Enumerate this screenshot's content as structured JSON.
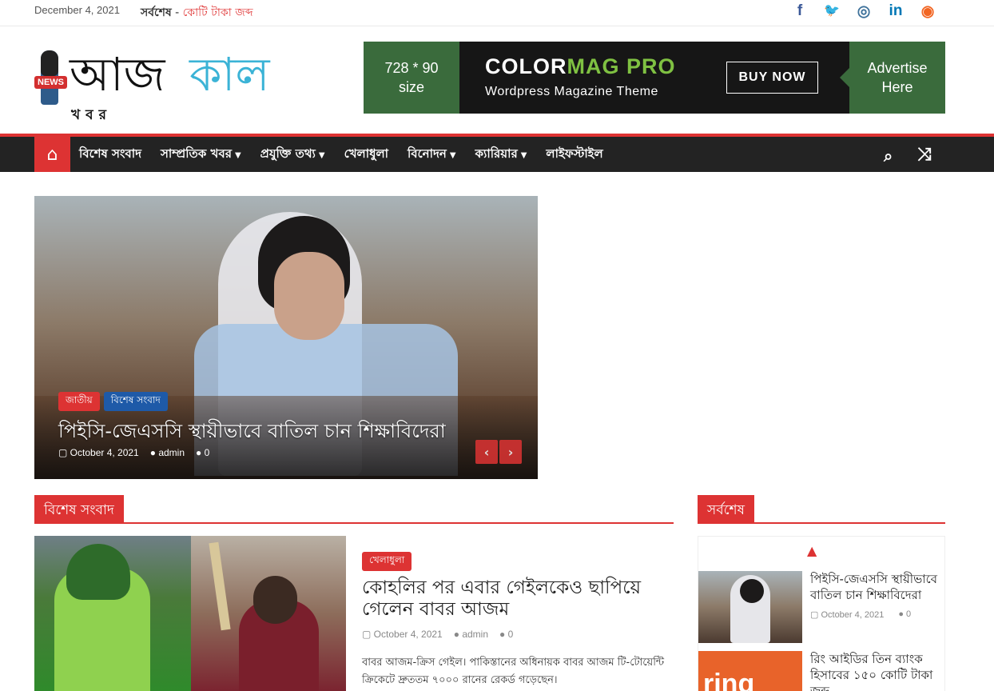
{
  "topbar": {
    "date": "December 4, 2021",
    "breaking_label": "সর্বশেষ",
    "breaking_sep": " - ",
    "breaking_text": "কোটি টাকা জব্দ"
  },
  "social": [
    {
      "icon": "facebook-icon",
      "glyph": "f",
      "color": "#3b5998"
    },
    {
      "icon": "twitter-icon",
      "glyph": "🐦",
      "color": "#1da1f2"
    },
    {
      "icon": "instagram-icon",
      "glyph": "◎",
      "color": "#3f729b"
    },
    {
      "icon": "linkedin-icon",
      "glyph": "in",
      "color": "#0077b5"
    },
    {
      "icon": "rss-icon",
      "glyph": "◉",
      "color": "#f26522"
    }
  ],
  "logo": {
    "part1": "আজ",
    "part2": "কাল",
    "sub": "খবর",
    "badge": "NEWS"
  },
  "ad": {
    "size_line1": "728 * 90",
    "size_line2": "size",
    "brand_main": "COLOR",
    "brand_accent": "MAG PRO",
    "tagline": "Wordpress Magazine Theme",
    "buy": "BUY NOW",
    "advertise_line1": "Advertise",
    "advertise_line2": "Here"
  },
  "nav": {
    "home_icon": "home-icon",
    "items": [
      {
        "label": "বিশেষ সংবাদ",
        "dropdown": false
      },
      {
        "label": "সাম্প্রতিক খবর",
        "dropdown": true
      },
      {
        "label": "প্রযুক্তি তথ্য",
        "dropdown": true
      },
      {
        "label": "খেলাধুলা",
        "dropdown": false
      },
      {
        "label": "বিনোদন",
        "dropdown": true
      },
      {
        "label": "ক্যারিয়ার",
        "dropdown": true
      },
      {
        "label": "লাইফস্টাইল",
        "dropdown": false
      }
    ]
  },
  "slider": {
    "categories": [
      "জাতীয়",
      "বিশেষ সংবাদ"
    ],
    "title": "পিইসি-জেএসসি স্থায়ীভাবে বাতিল চান শিক্ষাবিদেরা",
    "date": "October 4, 2021",
    "author": "admin",
    "comments": "0"
  },
  "section_left": {
    "title": "বিশেষ সংবাদ"
  },
  "section_right": {
    "title": "সর্বশেষ"
  },
  "article": {
    "category": "খেলাধুলা",
    "title": "কোহলির পর এবার গেইলকেও ছাপিয়ে গেলেন বাবর আজম",
    "date": "October 4, 2021",
    "author": "admin",
    "comments": "0",
    "excerpt": "বাবর আজম-ক্রিস গেইল। পাকিস্তানের অধিনায়ক বাবর আজম টি-টোয়েন্টি ক্রিকেটে দ্রুততম ৭০০০ রানের রেকর্ড গড়েছেন।"
  },
  "sidebar": [
    {
      "title": "পিইসি-জেএসসি স্থায়ীভাবে বাতিল চান শিক্ষাবিদেরা",
      "date": "October 4, 2021",
      "comments": "0"
    },
    {
      "title": "রিং আইডির তিন ব্যাংক হিসাবের ১৫০ কোটি টাকা জব্দ",
      "thumb_text": "ring"
    }
  ]
}
